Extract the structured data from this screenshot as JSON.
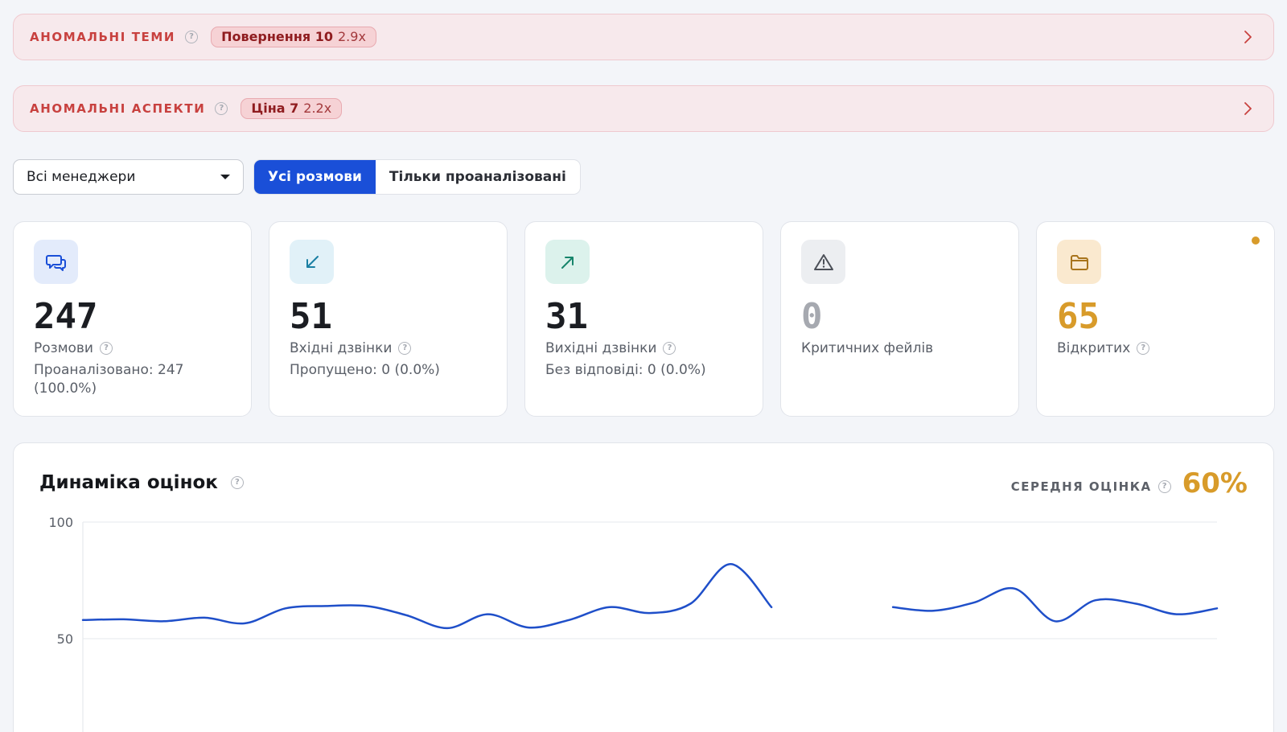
{
  "anomalies": [
    {
      "title": "АНОМАЛЬНІ ТЕМИ",
      "pill_name": "Повернення 10",
      "pill_mult": "2.9x"
    },
    {
      "title": "АНОМАЛЬНІ АСПЕКТИ",
      "pill_name": "Ціна 7",
      "pill_mult": "2.2x"
    }
  ],
  "filters": {
    "manager_select": "Всі менеджери",
    "tabs": [
      {
        "label": "Усі розмови",
        "active": true
      },
      {
        "label": "Тільки проаналізовані",
        "active": false
      }
    ]
  },
  "cards": [
    {
      "icon": "chat-bubbles-icon",
      "value": "247",
      "label": "Розмови",
      "sub": "Проаналізовано: 247 (100.0%)"
    },
    {
      "icon": "incoming-arrow-icon",
      "value": "51",
      "label": "Вхідні дзвінки",
      "sub": "Пропущено: 0 (0.0%)"
    },
    {
      "icon": "outgoing-arrow-icon",
      "value": "31",
      "label": "Вихідні дзвінки",
      "sub": "Без відповіді: 0 (0.0%)"
    },
    {
      "icon": "warning-triangle-icon",
      "value": "0",
      "label": "Критичних фейлів",
      "sub": ""
    },
    {
      "icon": "folder-icon",
      "value": "65",
      "label": "Відкритих",
      "sub": ""
    }
  ],
  "colors": {
    "accent": "#1a4fd8",
    "anomaly_text": "#c8413f",
    "warning": "#d89b2a",
    "muted_value": "#a6a9b0",
    "line": "#1f4fc9"
  },
  "panel": {
    "title": "Динаміка оцінок",
    "avg_label": "СЕРЕДНЯ ОЦІНКА",
    "avg_value": "60%"
  },
  "chart_data": {
    "type": "line",
    "title": "Динаміка оцінок",
    "xlabel": "",
    "ylabel": "",
    "ylim": [
      0,
      100
    ],
    "yticks": [
      100,
      50
    ],
    "grid": true,
    "series": [
      {
        "values": [
          58,
          58.3,
          57.5,
          59,
          56.6,
          63,
          64,
          64,
          60,
          54.5,
          60.5,
          54.8,
          58,
          63.5,
          61,
          65,
          82,
          63.5,
          null,
          null,
          63.5,
          62,
          65.5,
          71.5,
          57.5,
          66.5,
          65,
          60.5,
          63
        ]
      }
    ]
  }
}
